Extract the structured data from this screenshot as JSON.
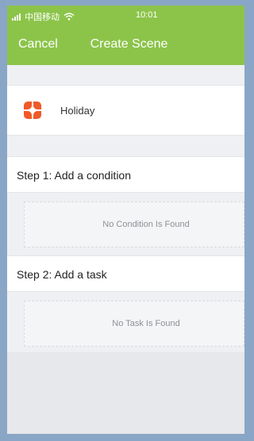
{
  "status_bar": {
    "carrier": "中国移动",
    "time": "10:01"
  },
  "header": {
    "cancel_label": "Cancel",
    "title": "Create Scene"
  },
  "scene": {
    "name": "Holiday",
    "icon": "scene-flower-icon",
    "icon_color": "#f05a28"
  },
  "steps": [
    {
      "title": "Step 1: Add a condition",
      "empty_text": "No Condition Is Found"
    },
    {
      "title": "Step 2: Add a task",
      "empty_text": "No Task Is Found"
    }
  ],
  "colors": {
    "header_bg": "#8cc44a",
    "frame_bg": "#8aa6c6"
  }
}
